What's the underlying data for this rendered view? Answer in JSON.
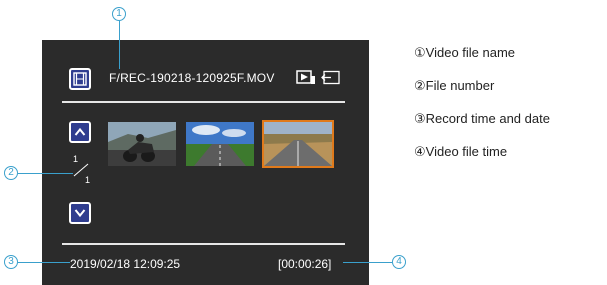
{
  "player": {
    "file_name": "F/REC-190218-120925F.MOV",
    "file_number_current": "1",
    "file_number_total": "1",
    "record_datetime": "2019/02/18 12:09:25",
    "video_time": "[00:00:26]"
  },
  "callouts": {
    "c1": "1",
    "c2": "2",
    "c3": "3",
    "c4": "4"
  },
  "legend": {
    "item1": "①Video file name",
    "item2": "②File number",
    "item3": "③Record time and date",
    "item4": "④Video file time"
  },
  "colors": {
    "screen_bg": "#2b2b2b",
    "button_bg": "#2f3d8f",
    "selected_outline": "#e07a1b",
    "callout": "#3aa0cc"
  },
  "icons": [
    "film-icon",
    "play-icon",
    "exit-icon",
    "arrow-up-icon",
    "arrow-down-icon"
  ]
}
